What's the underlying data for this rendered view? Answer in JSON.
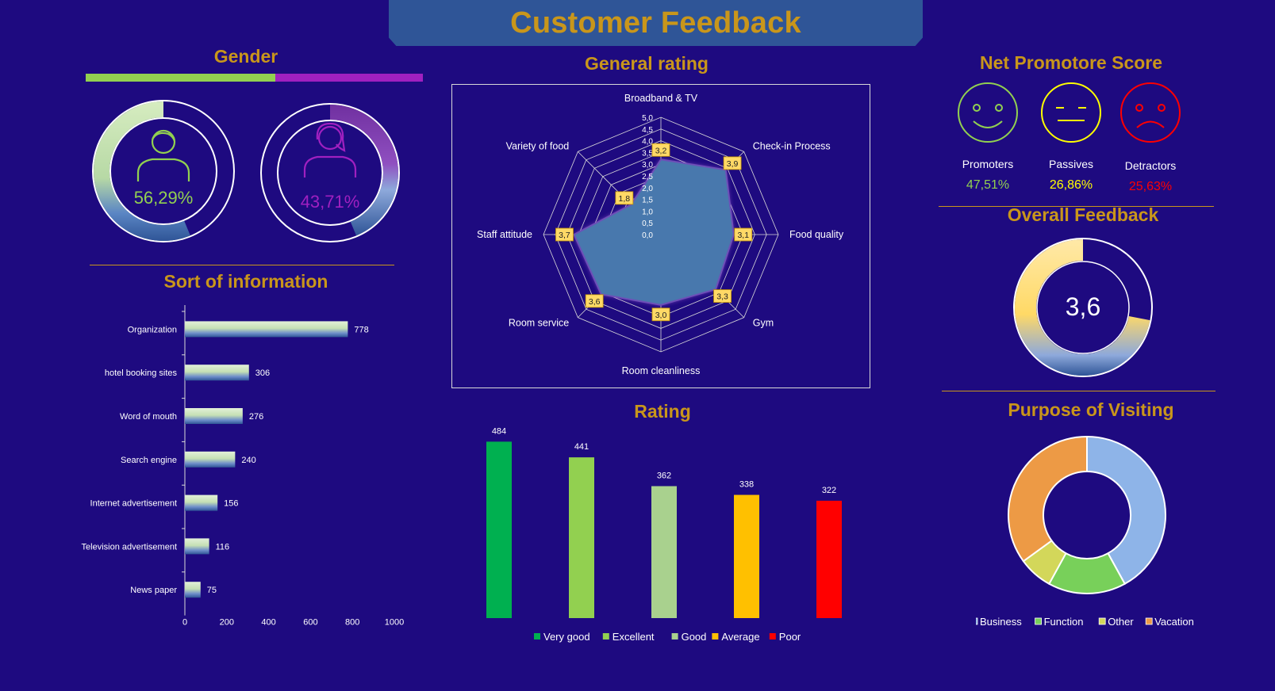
{
  "page": {
    "title": "Customer Feedback"
  },
  "gender": {
    "title": "Gender",
    "colors": {
      "male": "#92d050",
      "female": "#a020c0"
    },
    "male": {
      "icon": "male-user-icon",
      "percent": 56.29,
      "label": "56,29%"
    },
    "female": {
      "icon": "female-user-icon",
      "percent": 43.71,
      "label": "43,71%"
    }
  },
  "general_rating": {
    "title": "General rating",
    "chart_data": {
      "type": "radar",
      "categories": [
        "Broadband & TV",
        "Check-in Process",
        "Food quality",
        "Gym",
        "Room cleanliness",
        "Room service",
        "Staff attitude",
        "Variety of food"
      ],
      "values": [
        3.2,
        3.9,
        3.1,
        3.3,
        3.0,
        3.6,
        3.7,
        1.8
      ],
      "value_labels": [
        "3,2",
        "3,9",
        "3,1",
        "3,3",
        "3,0",
        "3,6",
        "3,7",
        "1,8"
      ],
      "rlim": [
        0,
        5
      ],
      "ticks": [
        "0,0",
        "0,5",
        "1,0",
        "1,5",
        "2,0",
        "2,5",
        "3,0",
        "3,5",
        "4,0",
        "4,5",
        "5,0"
      ]
    }
  },
  "nps": {
    "title": "Net Promotore Score",
    "items": [
      {
        "label": "Promoters",
        "value": "47,51%",
        "color": "#92d050",
        "icon": "smiley-face-icon"
      },
      {
        "label": "Passives",
        "value": "26,86%",
        "color": "#ffff00",
        "icon": "neutral-face-icon"
      },
      {
        "label": "Detractors",
        "value": "25,63%",
        "color": "#ff0000",
        "icon": "sad-face-icon"
      }
    ]
  },
  "overall": {
    "title": "Overall Feedback",
    "value_label": "3,6",
    "value": 3.6,
    "max": 5
  },
  "sort_info": {
    "title": "Sort of information",
    "chart_data": {
      "type": "bar",
      "orientation": "horizontal",
      "categories": [
        "Organization",
        "hotel booking sites",
        "Word of mouth",
        "Search engine",
        "Internet advertisement",
        "Television advertisement",
        "News paper"
      ],
      "values": [
        778,
        306,
        276,
        240,
        156,
        116,
        75
      ],
      "xlim": [
        0,
        1000
      ],
      "ticks": [
        0,
        200,
        400,
        600,
        800,
        1000
      ]
    }
  },
  "rating": {
    "title": "Rating",
    "chart_data": {
      "type": "bar",
      "categories": [
        "Very good",
        "Excellent",
        "Good",
        "Average",
        "Poor"
      ],
      "values": [
        484,
        441,
        362,
        338,
        322
      ],
      "colors": [
        "#00b050",
        "#92d050",
        "#a9d18e",
        "#ffc000",
        "#ff0000"
      ],
      "legend": "bottom"
    }
  },
  "purpose": {
    "title": "Purpose of Visiting",
    "chart_data": {
      "type": "pie",
      "donut": true,
      "labels": [
        "Business",
        "Function",
        "Other",
        "Vacation"
      ],
      "values": [
        42,
        16,
        7,
        35
      ],
      "colors": [
        "#8eb4e8",
        "#78d05a",
        "#d3d75a",
        "#ed9a45"
      ],
      "legend": "bottom"
    }
  }
}
